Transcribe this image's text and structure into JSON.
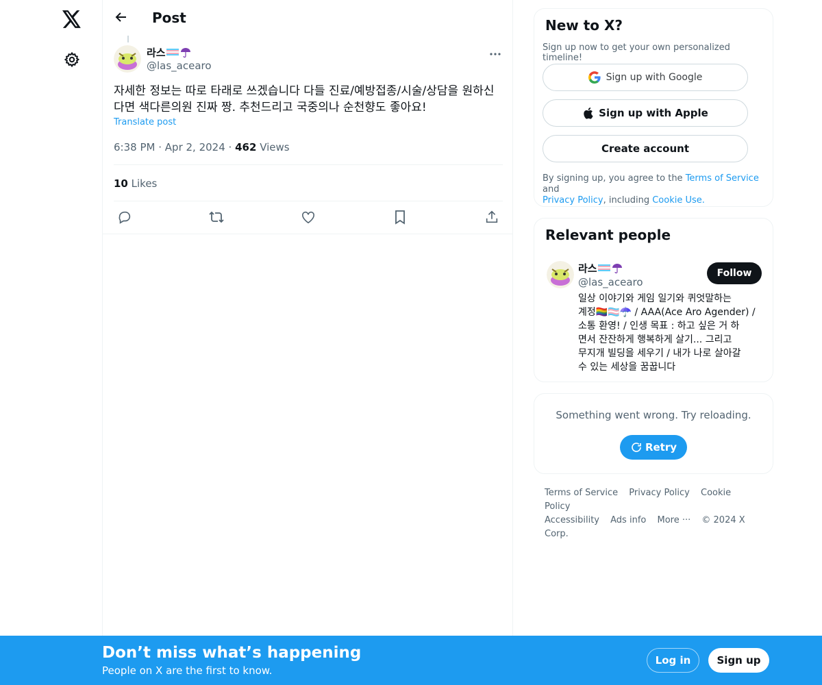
{
  "nav": {
    "logo_icon": "x-logo-icon",
    "settings_icon": "gear-icon"
  },
  "header": {
    "title": "Post",
    "back_icon": "arrow-left-icon"
  },
  "post": {
    "author_name": "라스",
    "author_emoji": "🏳️‍⚧️☂️",
    "author_handle": "@las_acearo",
    "text": "자세한 정보는 따로 타래로 쓰겠습니다 다들 진료/예방접종/시술/상담을 원하신다면 색다른의원 진짜 짱. 추천드리고 국중의나 순천향도 좋아요!",
    "translate_label": "Translate post",
    "time": "6:38 PM",
    "date": "Apr 2, 2024",
    "views_count": "462",
    "views_label": "Views",
    "likes_count": "10",
    "likes_label": "Likes",
    "actions": [
      "reply-icon",
      "repost-icon",
      "like-icon",
      "bookmark-icon",
      "share-icon"
    ]
  },
  "new_to_x": {
    "title": "New to X?",
    "subtitle": "Sign up now to get your own personalized timeline!",
    "google_label": "Sign up with Google",
    "apple_label": "Sign up with Apple",
    "create_label": "Create account",
    "legal_prefix": "By signing up, you agree to the",
    "terms": "Terms of Service",
    "and": "and",
    "privacy": "Privacy Policy",
    "including": ", including",
    "cookie": "Cookie Use."
  },
  "relevant_people": {
    "title": "Relevant people",
    "name": "라스",
    "handle": "@las_acearo",
    "follow_label": "Follow",
    "bio_lines": [
      "일상 이야기와 게임 일기와 퀴엇말하는",
      "계정🏳️‍🌈🏳️‍⚧️☂️ / AAA(Ace Aro Agender) /",
      "소통 환영! / 인생 목표 : 하고 싶은 거 하",
      "면서 잔잔하게 행복하게 살기... 그리고",
      "무지개 빌딩을 세우기 / 내가 나로 살아갈",
      "수 있는 세상을 꿈꿉니다"
    ]
  },
  "error": {
    "message": "Something went wrong. Try reloading.",
    "retry_label": "Retry"
  },
  "footer": {
    "links_row1": [
      "Terms of Service",
      "Privacy Policy",
      "Cookie Policy"
    ],
    "links_row2": [
      "Accessibility",
      "Ads info",
      "More ···",
      "© 2024 X Corp."
    ]
  },
  "banner": {
    "title": "Don’t miss what’s happening",
    "subtitle": "People on X are the first to know.",
    "login_label": "Log in",
    "signup_label": "Sign up"
  },
  "colors": {
    "accent": "#1d9bf0",
    "text": "#0f1419",
    "muted": "#536471",
    "border": "#eff3f4"
  }
}
